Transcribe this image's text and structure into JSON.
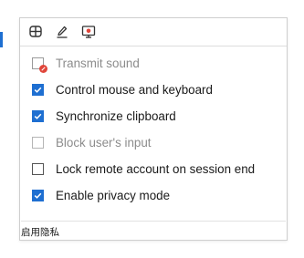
{
  "toolbar": {
    "buttons": [
      {
        "name": "display-toolbar-button",
        "icon": "monitor-cross-icon"
      },
      {
        "name": "pen-toolbar-button",
        "icon": "pen-icon"
      },
      {
        "name": "screen-record-toolbar-button",
        "icon": "screen-record-icon"
      }
    ]
  },
  "menu": {
    "items": [
      {
        "label": "Transmit sound",
        "state": "blocked",
        "enabled": false
      },
      {
        "label": "Control mouse and keyboard",
        "state": "checked",
        "enabled": true
      },
      {
        "label": "Synchronize clipboard",
        "state": "checked",
        "enabled": true
      },
      {
        "label": "Block user's input",
        "state": "unchecked",
        "enabled": false
      },
      {
        "label": "Lock remote account on session end",
        "state": "unchecked",
        "enabled": true
      },
      {
        "label": "Enable privacy mode",
        "state": "checked",
        "enabled": true
      }
    ]
  },
  "status": {
    "text": "启用隐私"
  },
  "colors": {
    "accent": "#1e6fd1",
    "record_red": "#e0453a",
    "disabled_text": "#8c8c8c"
  }
}
